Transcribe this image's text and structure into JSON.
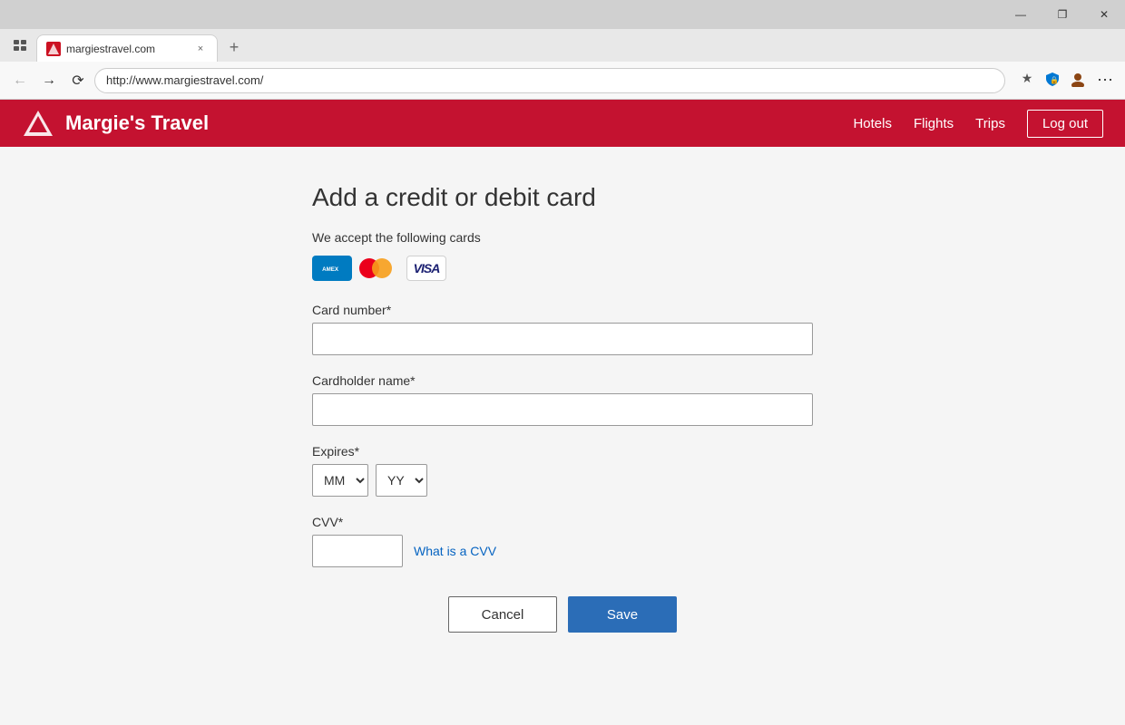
{
  "browser": {
    "tab": {
      "favicon_text": "M",
      "title": "margiestravel.com",
      "close_label": "×"
    },
    "new_tab_label": "+",
    "address": "http://www.margiestravel.com/",
    "window_controls": {
      "minimize": "—",
      "maximize": "❐",
      "close": "✕"
    },
    "menu_dots": "⋯"
  },
  "header": {
    "logo_text": "Margie's Travel",
    "nav_items": [
      "Hotels",
      "Flights",
      "Trips"
    ],
    "logout_label": "Log out"
  },
  "form": {
    "title": "Add a credit or debit card",
    "accepted_cards_label": "We accept the following cards",
    "card_number_label": "Card number*",
    "card_number_placeholder": "",
    "cardholder_name_label": "Cardholder name*",
    "cardholder_name_placeholder": "",
    "expires_label": "Expires*",
    "month_default": "MM",
    "year_default": "YY",
    "cvv_label": "CVV*",
    "cvv_placeholder": "",
    "what_is_cvv_label": "What is a CVV",
    "cancel_label": "Cancel",
    "save_label": "Save"
  }
}
